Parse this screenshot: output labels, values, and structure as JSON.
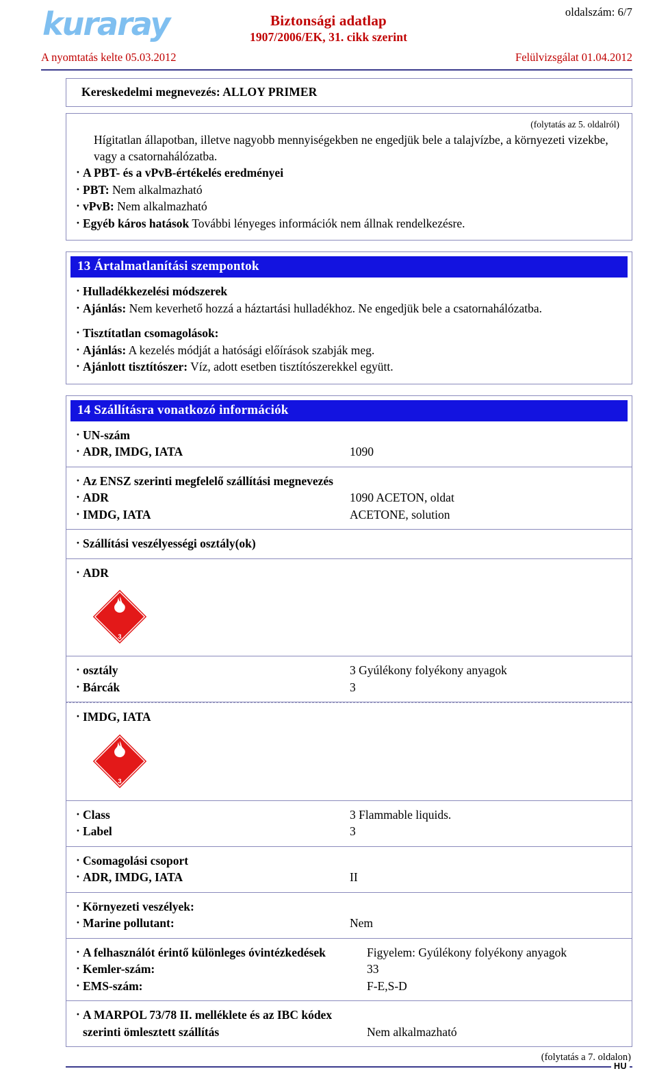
{
  "header": {
    "logo_text": "kuraray",
    "page_number_label": "oldalszám: 6/7",
    "title_main": "Biztonsági adatlap",
    "title_sub": "1907/2006/EK, 31. cikk szerint",
    "print_date": "A nyomtatás kelte 05.03.2012",
    "revision_date": "Felülvizsgálat 01.04.2012"
  },
  "trade": {
    "label": "Kereskedelmi megnevezés: ALLOY PRIMER"
  },
  "continuation": {
    "from_previous": "(folytatás az 5. oldalról)",
    "to_next": "(folytatás a 7. oldalon)",
    "language_code": "HU"
  },
  "section12_tail": {
    "paragraph": "Hígitatlan állapotban, illetve nagyobb mennyiségekben ne engedjük bele a talajvízbe, a környezeti vizekbe, vagy a csatornahálózatba.",
    "lines": [
      {
        "bold": "A PBT- és a vPvB-értékelés eredményei",
        "rest": ""
      },
      {
        "bold": "PBT:",
        "rest": " Nem alkalmazható"
      },
      {
        "bold": "vPvB:",
        "rest": " Nem alkalmazható"
      },
      {
        "bold": "Egyéb káros hatások",
        "rest": " További lényeges információk nem állnak rendelkezésre."
      }
    ]
  },
  "section13": {
    "heading": "13 Ártalmatlanítási szempontok",
    "group_a": [
      {
        "bold": "Hulladékkezelési módszerek",
        "rest": ""
      },
      {
        "bold": "Ajánlás:",
        "rest": " Nem keverhető hozzá a háztartási hulladékhoz. Ne engedjük bele a csatornahálózatba."
      }
    ],
    "group_b": [
      {
        "bold": "Tisztítatlan csomagolások:",
        "rest": ""
      },
      {
        "bold": "Ajánlás:",
        "rest": " A kezelés módját a hatósági előírások szabják meg."
      },
      {
        "bold": "Ajánlott tisztítószer:",
        "rest": " Víz, adott esetben tisztítószerekkel együtt."
      }
    ]
  },
  "section14": {
    "heading": "14 Szállításra vonatkozó információk",
    "blocks": [
      {
        "name": "un-number",
        "rows": [
          {
            "label": "UN-szám",
            "value": ""
          },
          {
            "label": "ADR, IMDG, IATA",
            "value": "1090"
          }
        ]
      },
      {
        "name": "proper-shipping-name",
        "rows": [
          {
            "label": "Az ENSZ szerinti megfelelő szállítási megnevezés",
            "value": ""
          },
          {
            "label": "ADR",
            "value": "1090 ACETON, oldat"
          },
          {
            "label": "IMDG, IATA",
            "value": "ACETONE, solution"
          }
        ]
      },
      {
        "name": "transport-hazard-class",
        "rows": [
          {
            "label": "Szállítási veszélyességi osztály(ok)",
            "value": ""
          }
        ]
      },
      {
        "name": "adr-class",
        "rows": [
          {
            "label": "ADR",
            "value": ""
          }
        ]
      },
      {
        "name": "adr-class-values",
        "rows": [
          {
            "label": "osztály",
            "value": "3 Gyúlékony folyékony anyagok"
          },
          {
            "label": "Bárcák",
            "value": "3"
          }
        ]
      },
      {
        "name": "imdg-iata-class",
        "rows": [
          {
            "label": "IMDG, IATA",
            "value": ""
          }
        ]
      },
      {
        "name": "imdg-iata-class-values",
        "rows": [
          {
            "label": "Class",
            "value": "3 Flammable liquids."
          },
          {
            "label": "Label",
            "value": "3"
          }
        ]
      },
      {
        "name": "packing-group",
        "rows": [
          {
            "label": "Csomagolási csoport",
            "value": ""
          },
          {
            "label": "ADR, IMDG, IATA",
            "value": "II"
          }
        ]
      },
      {
        "name": "environmental-hazards",
        "rows": [
          {
            "label": "Környezeti veszélyek:",
            "value": ""
          },
          {
            "label": "Marine pollutant:",
            "value": "Nem"
          }
        ]
      },
      {
        "name": "special-precautions",
        "rows": [
          {
            "label": "A felhasználót érintő különleges óvintézkedések",
            "value": "Figyelem: Gyúlékony folyékony anyagok"
          },
          {
            "label": "Kemler-szám:",
            "value": "33"
          },
          {
            "label": "EMS-szám:",
            "value": "F-E,S-D"
          }
        ]
      },
      {
        "name": "marpol-ibc",
        "rows": [
          {
            "label": "A MARPOL 73/78 II. melléklete és az IBC kódex",
            "value": ""
          },
          {
            "label": "szerinti ömlesztett szállítás",
            "value": "Nem alkalmazható",
            "no_bullet": true
          }
        ]
      }
    ]
  },
  "hazard_labels": {
    "adr_diamond": {
      "icon": "flammable-liquid-diamond-icon",
      "class_number": "3",
      "background_color": "#E31919",
      "symbol_color": "#FFFFFF"
    },
    "imdg_diamond": {
      "icon": "flammable-liquid-diamond-icon",
      "class_number": "3",
      "background_color": "#E31919",
      "symbol_color": "#FFFFFF"
    }
  },
  "colors": {
    "section_bar": "#1313E0",
    "header_accent": "#C00000",
    "rule": "#3A3A8C",
    "box_border": "#8A8ABC",
    "logo": "#7FBFF0"
  }
}
